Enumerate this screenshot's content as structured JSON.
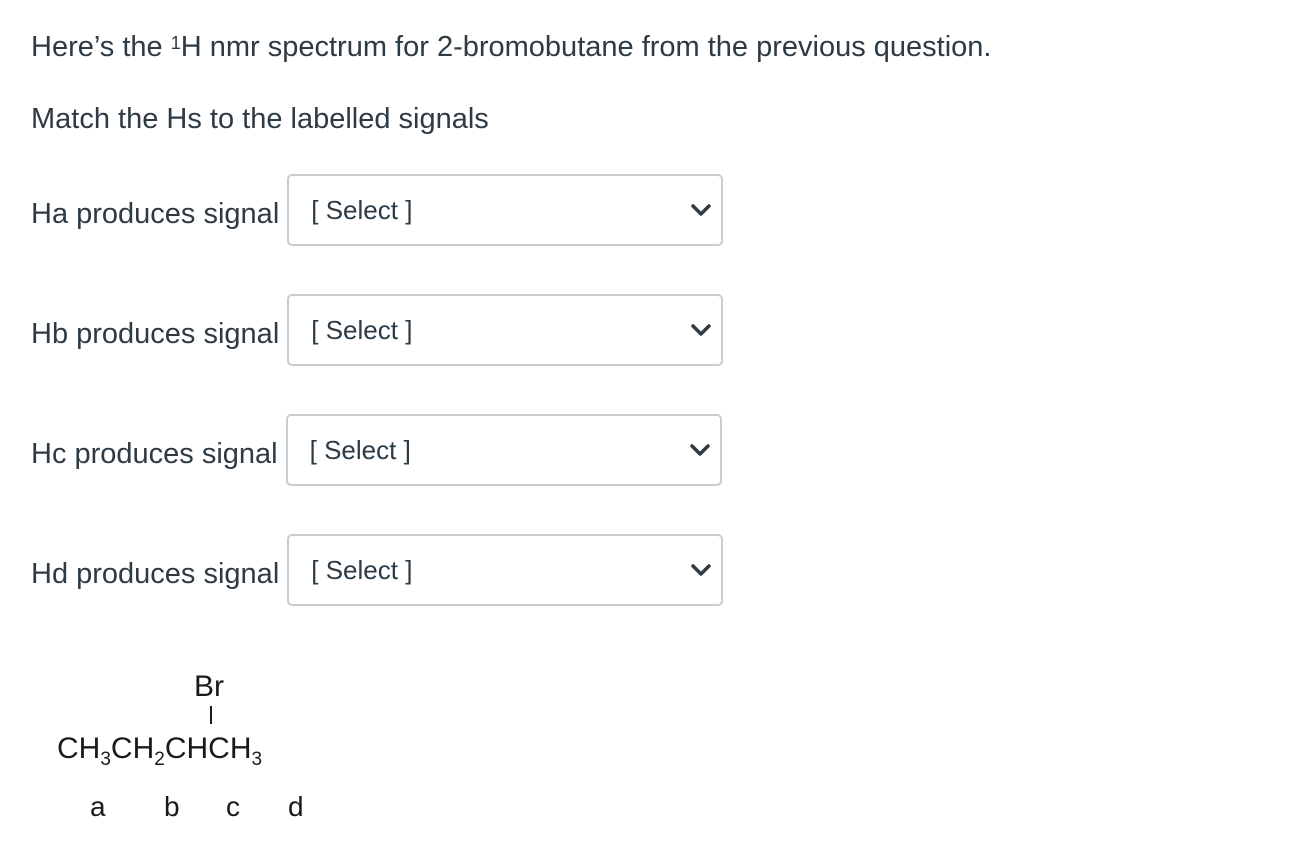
{
  "question": {
    "intro_before": "Here’s the ",
    "intro_sup": "1",
    "intro_after": "H nmr spectrum for 2-bromobutane from the previous question.",
    "instruction": "Match the Hs to the labelled signals"
  },
  "rows": [
    {
      "label": "Ha produces signal",
      "value": "[ Select ]"
    },
    {
      "label": "Hb produces signal",
      "value": "[ Select ]"
    },
    {
      "label": "Hc produces signal",
      "value": "[ Select ]"
    },
    {
      "label": "Hd produces signal",
      "value": "[ Select ]"
    }
  ],
  "molecule": {
    "substituent": "Br",
    "formula_parts": [
      "CH",
      "3",
      "CH",
      "2",
      "CHCH",
      "3"
    ],
    "labels": [
      "a",
      "b",
      "c",
      "d"
    ]
  },
  "icons": {
    "dropdown": "chevron-down-icon"
  }
}
